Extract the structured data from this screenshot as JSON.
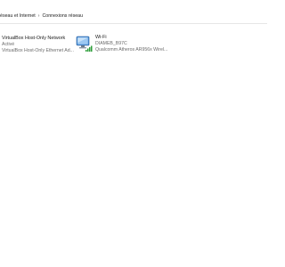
{
  "breadcrumb": {
    "items": [
      {
        "label": "éseau et Internet"
      },
      {
        "label": "Connexions réseau"
      }
    ],
    "separator": "›"
  },
  "connections": [
    {
      "name": "VirtualBox Host-Only Network",
      "status": "Activé",
      "adapter": "VirtualBox Host-Only Ethernet Ad...",
      "icon": "network-adapter-icon"
    },
    {
      "name": "Wi-Fi",
      "status": "DIAMEB_B97C",
      "adapter": "Qualcomm Atheros AR956x Wirel...",
      "icon": "wifi-adapter-icon"
    }
  ],
  "colors": {
    "signal": "#2e9e3a",
    "monitor": "#4a8fd6"
  }
}
